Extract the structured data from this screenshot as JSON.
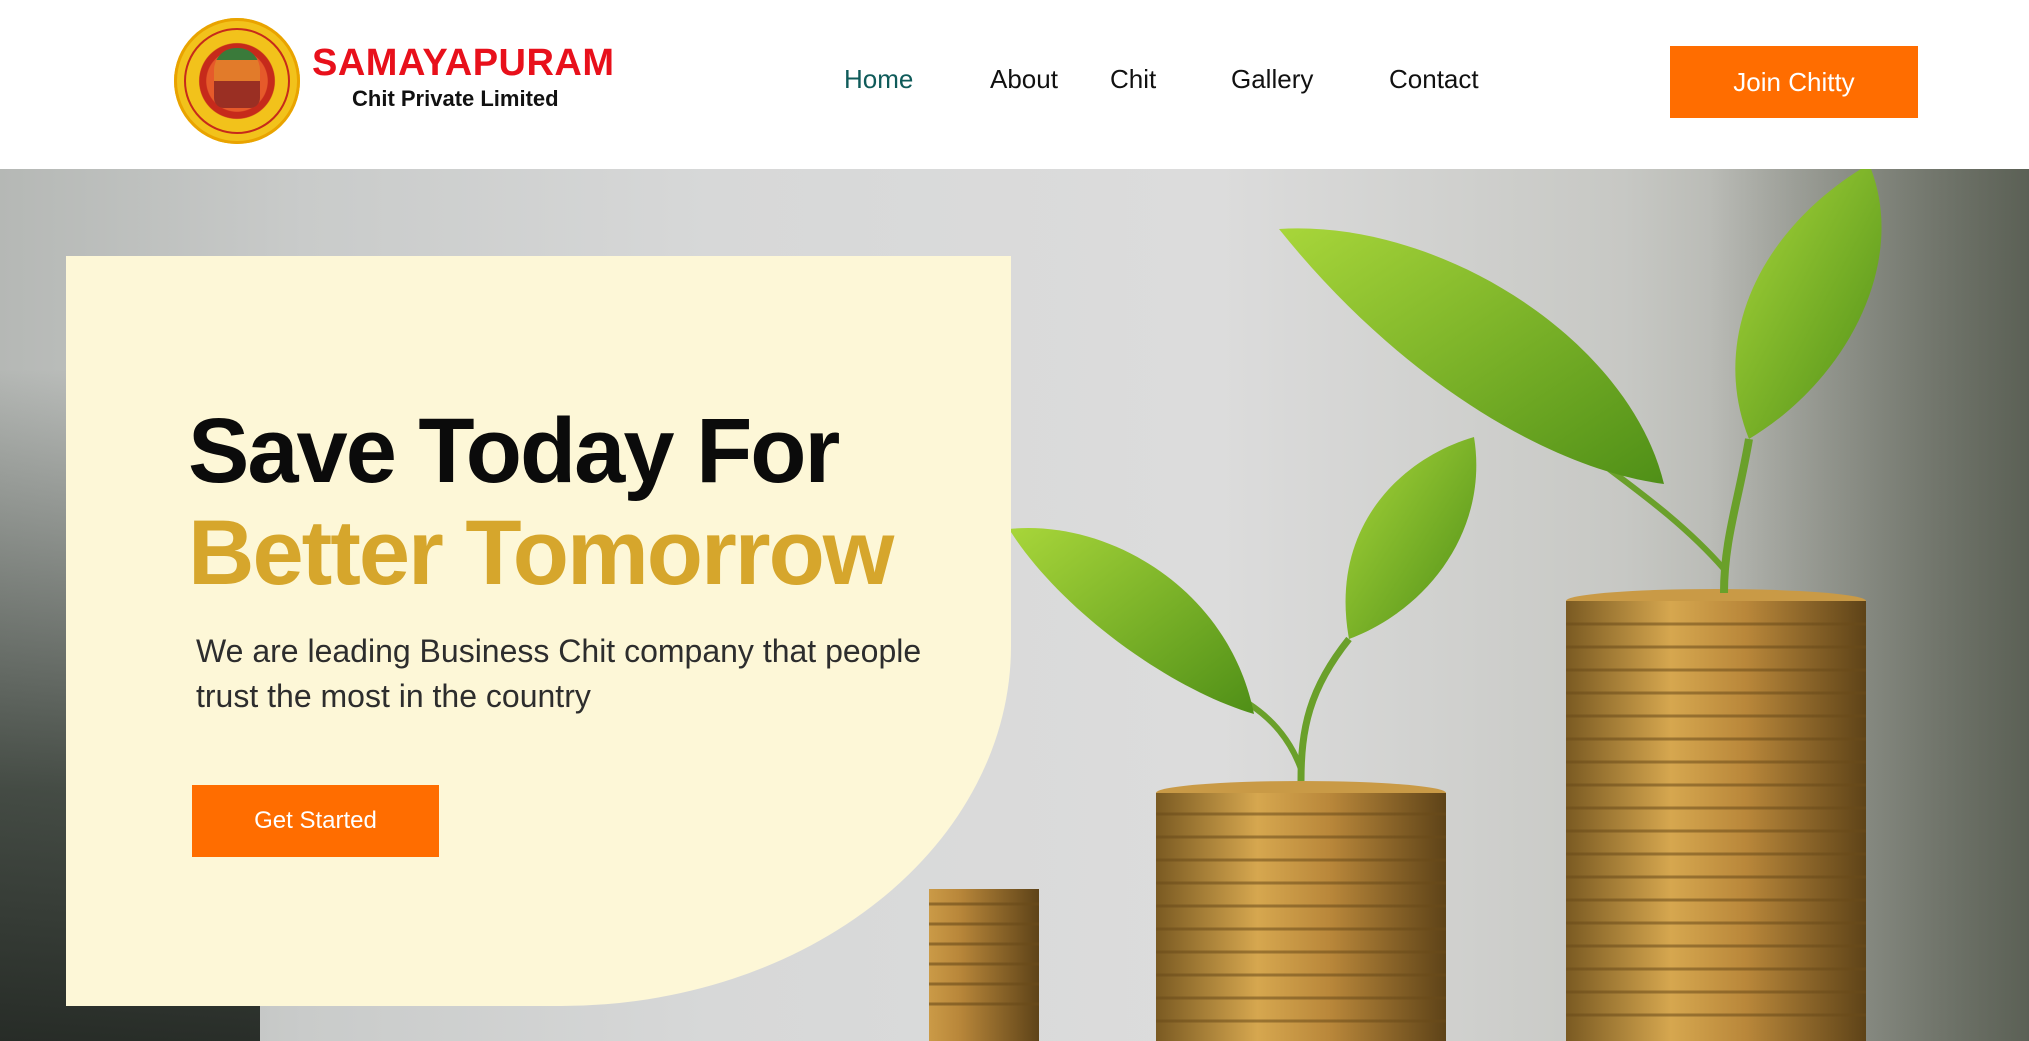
{
  "brand": {
    "title": "SAMAYAPURAM",
    "subtitle": "Chit Private Limited",
    "seal_text": "SAMAYAPURAM CHIT PRIVATE LIMITED"
  },
  "nav": {
    "items": [
      "Home",
      "About",
      "Chit",
      "Gallery",
      "Contact"
    ],
    "active": "Home"
  },
  "header": {
    "join_label": "Join Chitty"
  },
  "hero": {
    "headline_line1": "Save Today For",
    "headline_line2": "Better Tomorrow",
    "description": "We are leading Business Chit company that people trust the most in the country",
    "cta_label": "Get Started"
  },
  "colors": {
    "accent": "#ff6d00",
    "brand_red": "#e8101b",
    "gold": "#d6a62c",
    "nav_active": "#0f5b5a",
    "card_bg": "#fdf7d7"
  },
  "icons": [
    "logo-seal-icon",
    "coin-stack-icon",
    "plant-sprout-icon"
  ]
}
